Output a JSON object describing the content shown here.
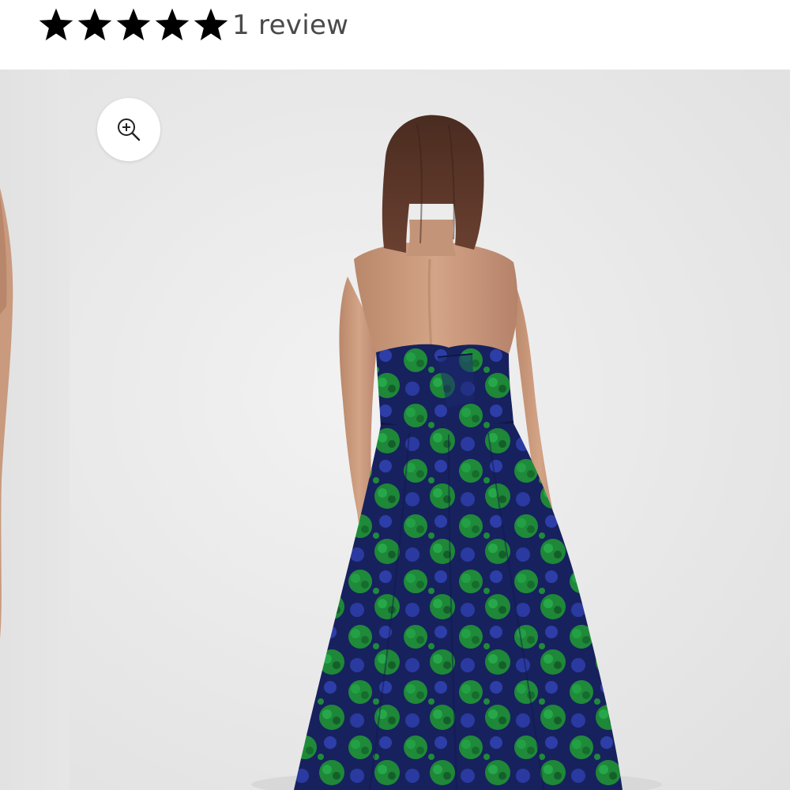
{
  "rating": {
    "value": 5,
    "max": 5,
    "review_count_label": "1 review",
    "star_color": "#000000"
  },
  "gallery": {
    "background_color": "#e9e9e9",
    "zoom_icon": "zoom-in-icon",
    "main_image": "woman-back-view-strapless-floral-jacquard-gown",
    "prev_image": "woman-side-view-partial",
    "dress_colors": {
      "base": "#1b2a6e",
      "floral": "#1f8a3a",
      "accent": "#2f3fb0"
    }
  }
}
